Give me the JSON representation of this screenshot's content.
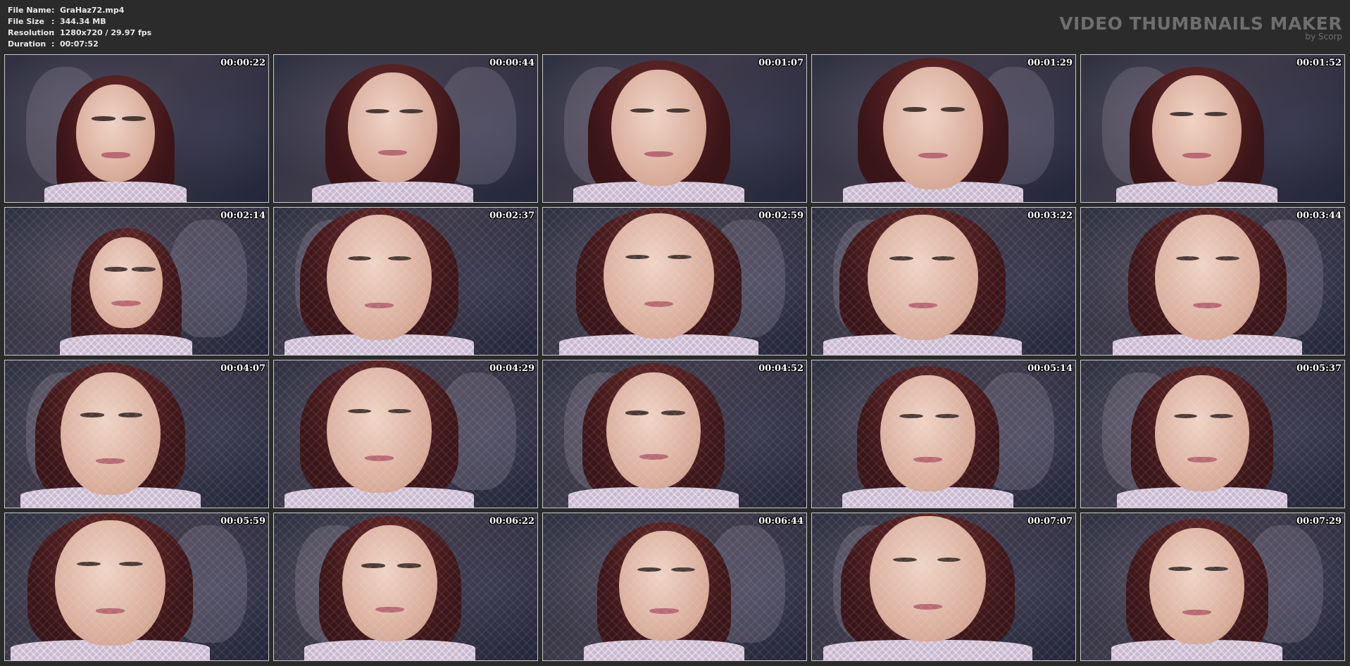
{
  "info": [
    {
      "key": "File Name",
      "sep": ":",
      "value": "GraHaz72.mp4"
    },
    {
      "key": "File Size",
      "sep": ":",
      "value": "344.34 MB"
    },
    {
      "key": "Resolution",
      "sep": ":",
      "value": "1280x720 / 29.97 fps"
    },
    {
      "key": "Duration",
      "sep": ":",
      "value": "00:07:52"
    }
  ],
  "brand": {
    "title": "VIDEO THUMBNAILS MAKER",
    "subtitle": "by Scorp"
  },
  "thumbnails": [
    {
      "time": "00:00:22"
    },
    {
      "time": "00:00:44"
    },
    {
      "time": "00:01:07"
    },
    {
      "time": "00:01:29"
    },
    {
      "time": "00:01:52"
    },
    {
      "time": "00:02:14"
    },
    {
      "time": "00:02:37"
    },
    {
      "time": "00:02:59"
    },
    {
      "time": "00:03:22"
    },
    {
      "time": "00:03:44"
    },
    {
      "time": "00:04:07"
    },
    {
      "time": "00:04:29"
    },
    {
      "time": "00:04:52"
    },
    {
      "time": "00:05:14"
    },
    {
      "time": "00:05:37"
    },
    {
      "time": "00:05:59"
    },
    {
      "time": "00:06:22"
    },
    {
      "time": "00:06:44"
    },
    {
      "time": "00:07:07"
    },
    {
      "time": "00:07:29"
    }
  ],
  "colors": {
    "background": "#2b2b2b",
    "info_text": "#e8e8e8",
    "brand_text": "#6e6e6e",
    "thumb_border": "#c8c8c8",
    "timestamp": "#ffffff"
  }
}
